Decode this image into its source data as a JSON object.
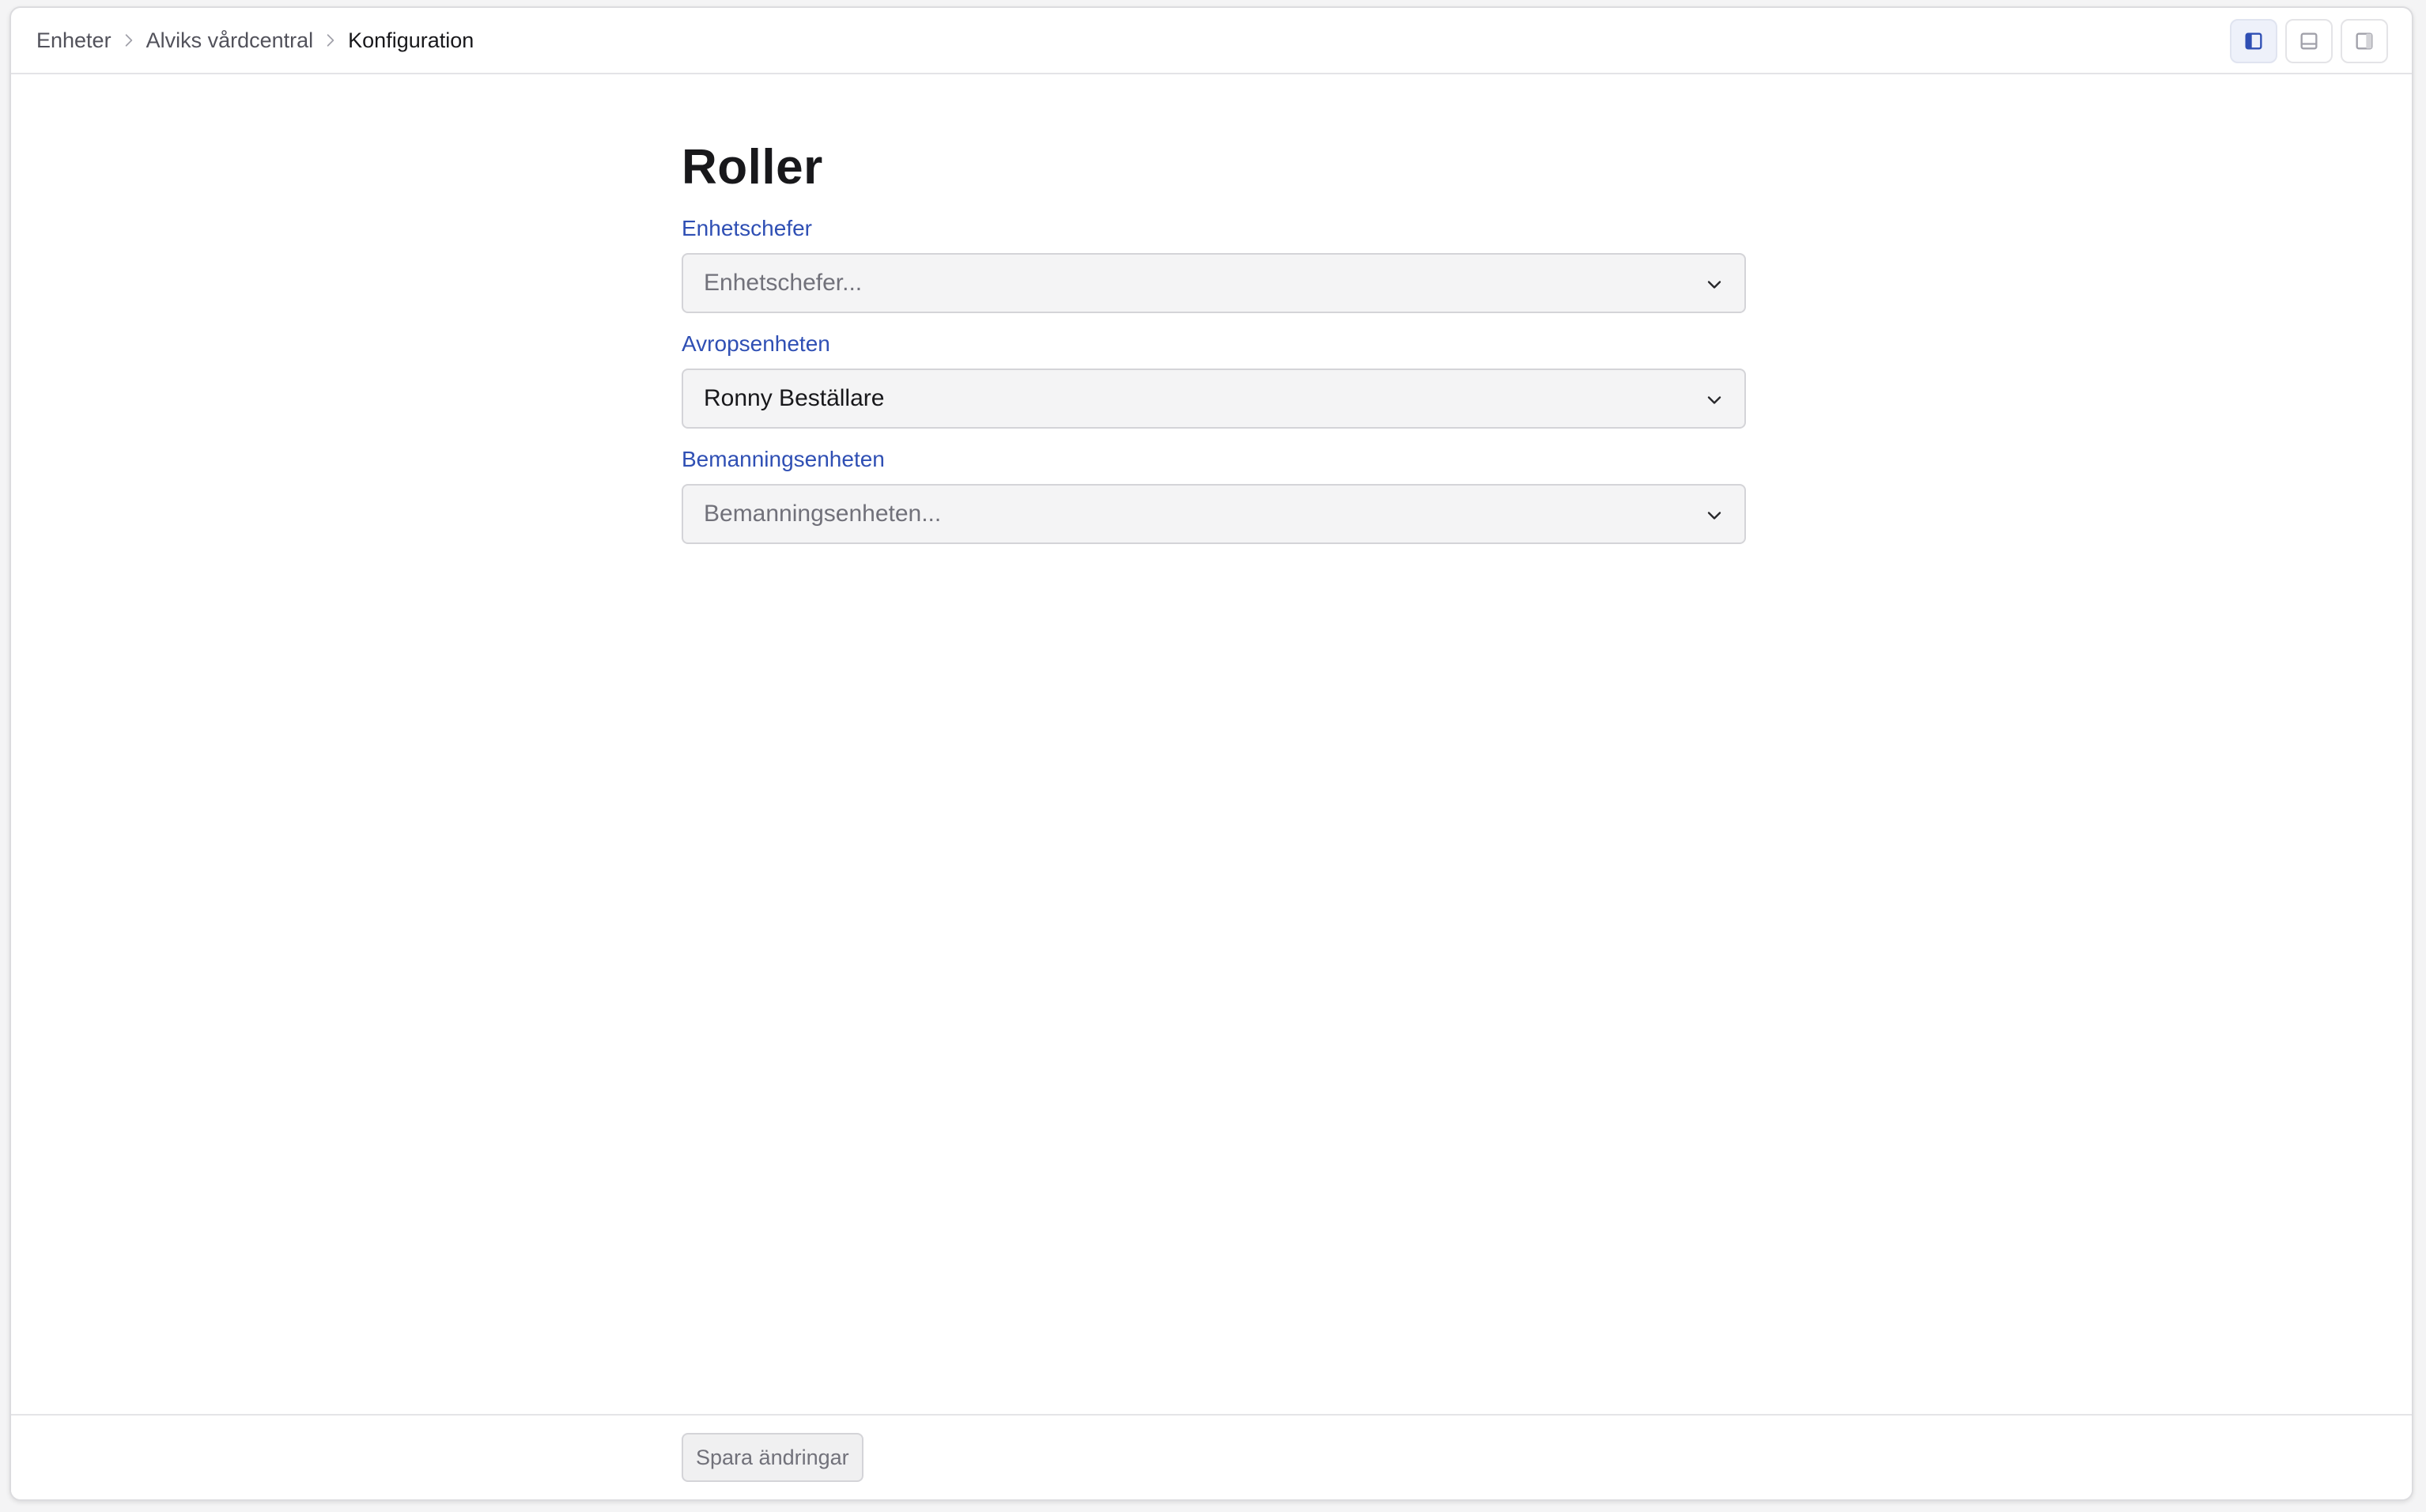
{
  "breadcrumb": {
    "items": [
      "Enheter",
      "Alviks vårdcentral"
    ],
    "current": "Konfiguration"
  },
  "layout_buttons": {
    "active": "left-panel"
  },
  "page": {
    "title": "Roller"
  },
  "fields": [
    {
      "label": "Enhetschefer",
      "placeholder": "Enhetschefer...",
      "value": ""
    },
    {
      "label": "Avropsenheten",
      "placeholder": "",
      "value": "Ronny Beställare"
    },
    {
      "label": "Bemanningsenheten",
      "placeholder": "Bemanningsenheten...",
      "value": ""
    }
  ],
  "footer": {
    "save_label": "Spara ändringar"
  },
  "colors": {
    "accent": "#2f4fb4",
    "layout_active_icon": "#2f4fb4"
  }
}
